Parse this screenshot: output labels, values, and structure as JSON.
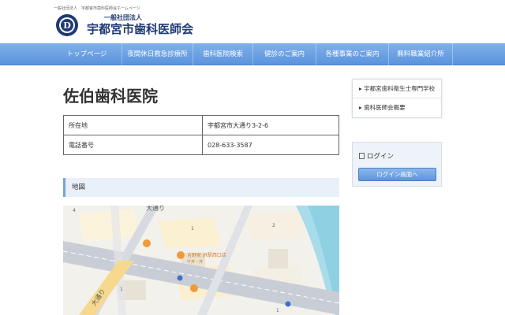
{
  "header": {
    "tagline": "一般社団法人　宇都宮市歯科医師会ホームページ",
    "logo_sub": "一般社団法人",
    "logo_title": "宇都宮市歯科医師会",
    "logo_mark_letter": "D"
  },
  "nav": {
    "items": [
      {
        "label": "トップページ"
      },
      {
        "label": "夜間休日救急診療所"
      },
      {
        "label": "歯科医院検索"
      },
      {
        "label": "健診のご案内"
      },
      {
        "label": "各種事業のご案内"
      },
      {
        "label": "無料職業紹介所"
      }
    ]
  },
  "main": {
    "title": "佐伯歯科医院",
    "info_rows": [
      {
        "label": "所在地",
        "value": "宇都宮市大通り3-2-6"
      },
      {
        "label": "電話番号",
        "value": "028-633-3587"
      }
    ],
    "map_heading": "地図"
  },
  "map": {
    "labels": {
      "street_top": "大通り",
      "street_left": "大通り",
      "poi_shop": "吉野家 JR駅西口店",
      "poi_shop_sub": "牛丼・丼",
      "n1": "4",
      "n2": "1",
      "n3": "2",
      "n4": "1",
      "n5": "1"
    }
  },
  "sidebar": {
    "links": [
      {
        "label": "宇都宮歯科衛生士専門学校"
      },
      {
        "label": "歯科医師会概要"
      }
    ],
    "login_title": "ログイン",
    "login_button": "ログイン画面へ"
  },
  "colors": {
    "brand_navy": "#1f3a73",
    "nav_blue": "#6aa0e2",
    "section_bg": "#e8f0fa"
  }
}
